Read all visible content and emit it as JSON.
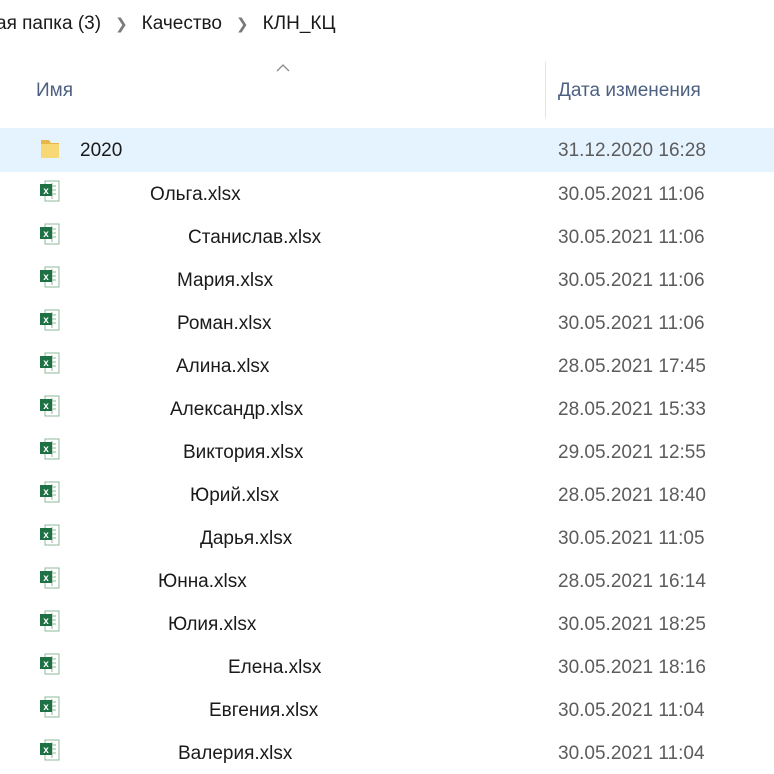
{
  "breadcrumb": [
    "ая папка (3)",
    "Качество",
    "КЛН_КЦ"
  ],
  "columns": {
    "name": "Имя",
    "date": "Дата изменения"
  },
  "items": [
    {
      "type": "folder",
      "name": "2020",
      "date": "31.12.2020 16:28",
      "icon": "folder-icon"
    },
    {
      "type": "xlsx",
      "name": "Ольга.xlsx",
      "date": "30.05.2021 11:06",
      "icon": "excel-file-icon"
    },
    {
      "type": "xlsx",
      "name": "Станислав.xlsx",
      "date": "30.05.2021 11:06",
      "icon": "excel-file-icon"
    },
    {
      "type": "xlsx",
      "name": "Мария.xlsx",
      "date": "30.05.2021 11:06",
      "icon": "excel-file-icon"
    },
    {
      "type": "xlsx",
      "name": "Роман.xlsx",
      "date": "30.05.2021 11:06",
      "icon": "excel-file-icon"
    },
    {
      "type": "xlsx",
      "name": "Алина.xlsx",
      "date": "28.05.2021 17:45",
      "icon": "excel-file-icon"
    },
    {
      "type": "xlsx",
      "name": "Александр.xlsx",
      "date": "28.05.2021 15:33",
      "icon": "excel-file-icon"
    },
    {
      "type": "xlsx",
      "name": "Виктория.xlsx",
      "date": "29.05.2021 12:55",
      "icon": "excel-file-icon"
    },
    {
      "type": "xlsx",
      "name": "Юрий.xlsx",
      "date": "28.05.2021 18:40",
      "icon": "excel-file-icon"
    },
    {
      "type": "xlsx",
      "name": "Дарья.xlsx",
      "date": "30.05.2021 11:05",
      "icon": "excel-file-icon"
    },
    {
      "type": "xlsx",
      "name": "Юнна.xlsx",
      "date": "28.05.2021 16:14",
      "icon": "excel-file-icon"
    },
    {
      "type": "xlsx",
      "name": "Юлия.xlsx",
      "date": "30.05.2021 18:25",
      "icon": "excel-file-icon"
    },
    {
      "type": "xlsx",
      "name": "Елена.xlsx",
      "date": "30.05.2021 18:16",
      "icon": "excel-file-icon"
    },
    {
      "type": "xlsx",
      "name": "Евгения.xlsx",
      "date": "30.05.2021 11:04",
      "icon": "excel-file-icon"
    },
    {
      "type": "xlsx",
      "name": "Валерия.xlsx",
      "date": "30.05.2021 11:04",
      "icon": "excel-file-icon"
    }
  ],
  "colors": {
    "selected_row": "#e5f3ff",
    "header_text": "#4d6082",
    "folder": "#f8d775",
    "excel_green": "#1e7145"
  }
}
